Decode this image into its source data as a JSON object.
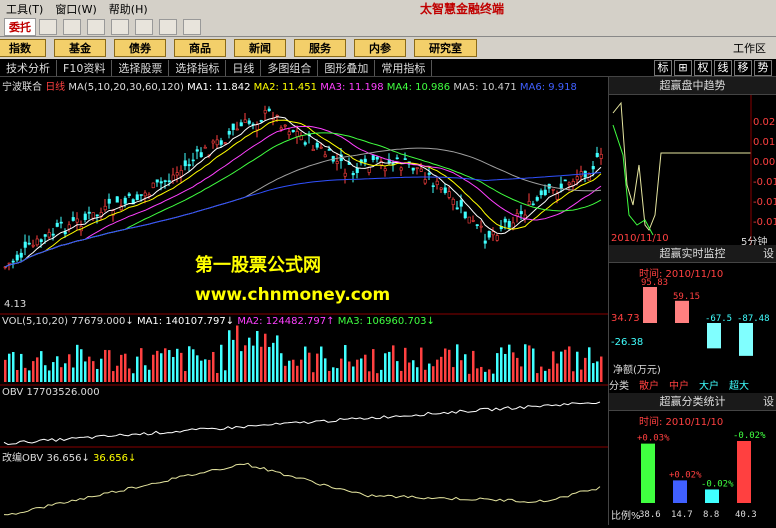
{
  "menu": [
    "工具(T)",
    "窗口(W)",
    "帮助(H)"
  ],
  "brand": "太智慧金融终端",
  "wt_label": "委托",
  "nav": [
    "指数",
    "基金",
    "债券",
    "商品",
    "新闻",
    "服务",
    "内参",
    "研究室"
  ],
  "work_area_label": "工作区",
  "toolbar": [
    "技术分析",
    "F10资料",
    "选择股票",
    "选择指标",
    "日线",
    "多图组合",
    "图形叠加",
    "常用指标"
  ],
  "right_tabs": [
    "标",
    "⊞",
    "权",
    "线",
    "移",
    "势"
  ],
  "stock": {
    "name": "宁波联合",
    "period": "日线",
    "ma_prefix": "MA(5,10,20,30,60,120)",
    "ma1": "MA1: 11.842",
    "ma2": "MA2: 11.451",
    "ma3": "MA3: 11.198",
    "ma4": "MA4: 10.986",
    "ma5": "MA5: 10.471",
    "ma6": "MA6: 9.918",
    "low_label": "4.13"
  },
  "watermark": {
    "line1": "第一股票公式网",
    "line2": "www.chnmoney.com"
  },
  "volume": {
    "label": "VOL(5,10,20)",
    "v1": "77679.000↓",
    "ma1": "MA1: 140107.797↓",
    "ma2": "MA2: 124482.797↑",
    "ma3": "MA3: 106960.703↓"
  },
  "obv": {
    "label": "OBV 17703526.000"
  },
  "mobv": {
    "label": "改编OBV",
    "v1": "36.656↓",
    "v2": "36.656↓"
  },
  "trend_panel": {
    "title": "超赢盘中趋势",
    "date": "2010/11/10",
    "period": "5分钟",
    "y_ticks": [
      "0.02",
      "0.01",
      "0.00",
      "-0.01",
      "-0.01",
      "-0.01",
      "-0.01"
    ]
  },
  "monitor_panel": {
    "title": "超赢实时监控",
    "time_label": "时间: 2010/11/10",
    "values": [
      "95.83",
      "59.15",
      "-67.5",
      "-87.48"
    ],
    "axis": [
      "34.73",
      "-26.38"
    ],
    "footer": "净额(万元)",
    "categories_label": "分类",
    "categories": [
      "散户",
      "中户",
      "大户",
      "超大"
    ],
    "setting": "设"
  },
  "stats_panel": {
    "title": "超赢分类统计",
    "time_label": "时间: 2010/11/10",
    "changes": [
      "+0.03%",
      "+0.02%",
      "-0.02%",
      "-0.02%"
    ],
    "ratios": [
      "38.6",
      "14.7",
      "8.8",
      "40.3"
    ],
    "ratio_label": "比例%",
    "setting": "设"
  },
  "chart_data": [
    {
      "type": "bar",
      "title": "超赢实时监控",
      "categories": [
        "散户",
        "中户",
        "大户",
        "超大"
      ],
      "values": [
        95.83,
        59.15,
        -67.5,
        -87.48
      ]
    },
    {
      "type": "bar",
      "title": "超赢分类统计",
      "categories": [
        "散户",
        "中户",
        "大户",
        "超大"
      ],
      "values": [
        38.6,
        14.7,
        8.8,
        40.3
      ]
    }
  ]
}
